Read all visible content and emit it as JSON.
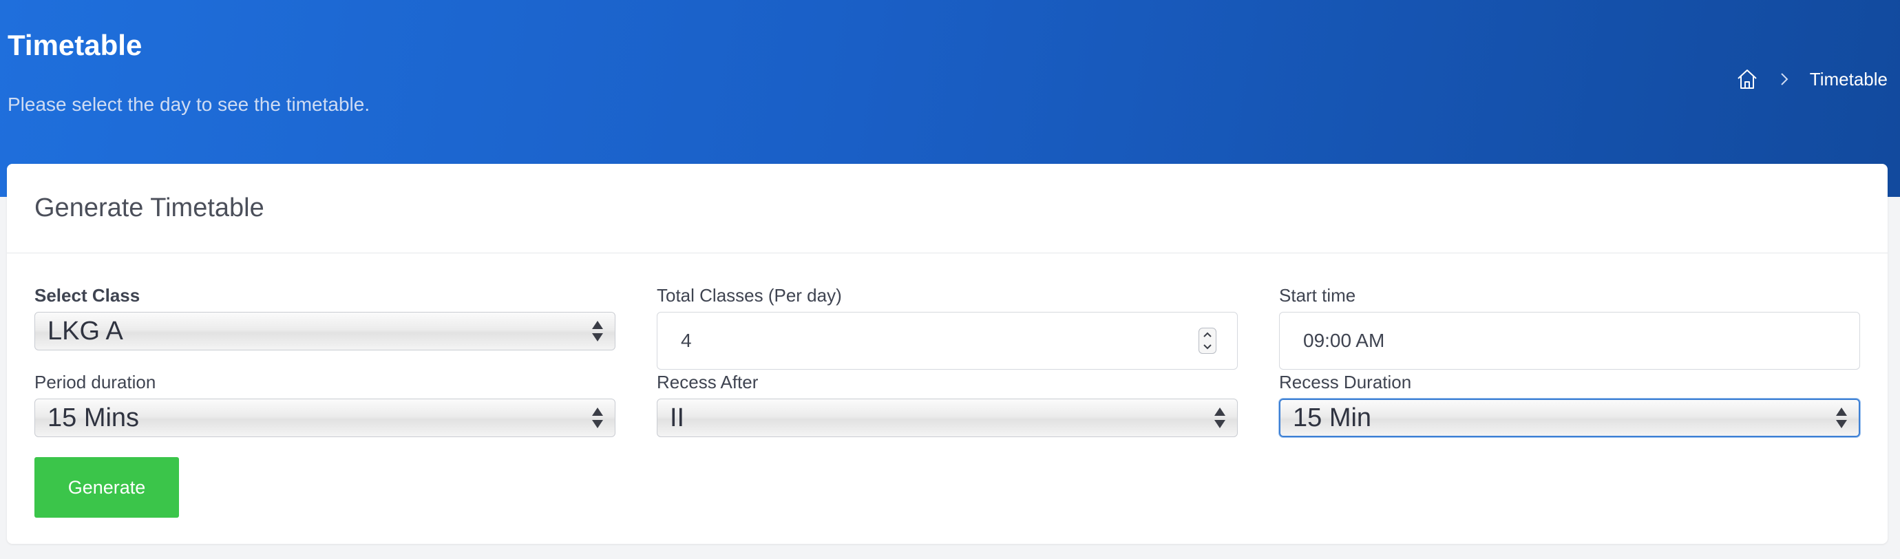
{
  "header": {
    "title": "Timetable",
    "subtitle": "Please select the day to see the timetable.",
    "breadcrumb": {
      "home_icon": "home-icon",
      "current": "Timetable"
    }
  },
  "card": {
    "title": "Generate Timetable",
    "fields": {
      "select_class": {
        "label": "Select Class",
        "value": "LKG A"
      },
      "total_classes": {
        "label": "Total Classes (Per day)",
        "value": "4"
      },
      "start_time": {
        "label": "Start time",
        "value": "09:00 AM"
      },
      "period_duration": {
        "label": "Period duration",
        "value": "15 Mins"
      },
      "recess_after": {
        "label": "Recess After",
        "value": "II"
      },
      "recess_duration": {
        "label": "Recess Duration",
        "value": "15 Min"
      }
    },
    "generate_label": "Generate"
  },
  "colors": {
    "header_gradient_start": "#1f6fdc",
    "header_gradient_end": "#124a9e",
    "generate_button": "#3bc54a",
    "focus_border": "#3c7fd4"
  }
}
